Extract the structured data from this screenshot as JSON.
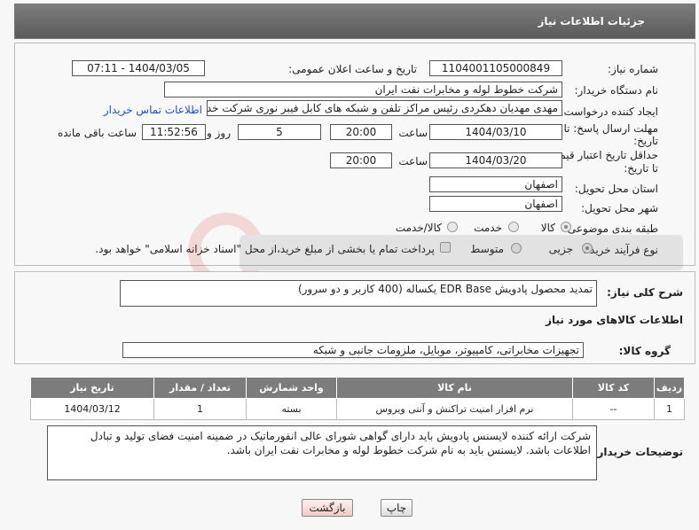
{
  "header": {
    "title": "جزئیات اطلاعات نیاز"
  },
  "form": {
    "need_number_label": "شماره نیاز:",
    "need_number": "1104001105000849",
    "announce_label": "تاریخ و ساعت اعلان عمومی:",
    "announce_value": "1404/03/05 - 07:11",
    "buyer_org_label": "نام دستگاه خریدار:",
    "buyer_org": "شرکت خطوط لوله و مخابرات نفت ایران",
    "requester_label": "ایجاد کننده درخواست:",
    "requester": "مهدی مهدیان دهکردی رئیس مراکز تلفن و شبکه های کابل فیبر نوری شرکت خد",
    "contact_link": "اطلاعات تماس خریدار",
    "reply_deadline_label": "مهلت ارسال پاسخ: تا",
    "reply_deadline_label2": "تاریخ:",
    "reply_date": "1404/03/10",
    "time_label": "ساعت",
    "reply_time": "20:00",
    "days_value": "5",
    "days_label": "روز و",
    "remaining_time": "11:52:56",
    "remaining_label": "ساعت باقی مانده",
    "price_deadline_label": "حداقل تاریخ اعتبار قیمت:",
    "price_deadline_label2": "تا تاریخ:",
    "price_date": "1404/03/20",
    "price_time": "20:00",
    "province_label": "استان محل تحویل:",
    "province": "اصفهان",
    "city_label": "شهر محل تحویل:",
    "city": "اصفهان",
    "category_label": "طبقه بندی موضوعی:",
    "category_options": [
      "کالا",
      "خدمت",
      "کالا/خدمت"
    ],
    "process_label": "نوع فرآیند خرید :",
    "process_options": [
      "جزیی",
      "متوسط"
    ],
    "payment_note": "پرداخت تمام یا بخشی از مبلغ خرید،از محل \"اسناد خزانه اسلامی\" خواهد بود."
  },
  "description": {
    "label": "شرح کلی نیاز:",
    "value": "تمدید محصول پادویش EDR Base یکساله (400 کاربر و دو سرور)"
  },
  "goods": {
    "section_title": "اطلاعات کالاهای مورد نیاز",
    "group_label": "گروه کالا:",
    "group_value": "تجهیزات مخابراتی، کامپیوتر، موبایل، ملزومات جانبی و شبکه",
    "columns": [
      "ردیف",
      "کد کالا",
      "نام کالا",
      "واحد شمارش",
      "تعداد / مقدار",
      "تاریخ نیاز"
    ],
    "rows": [
      [
        "1",
        "--",
        "نرم افزار امنیت تراکنش و آنتی ویروس",
        "بسته",
        "1",
        "1404/03/12"
      ]
    ]
  },
  "buyer_notes": {
    "label": "توضیحات خریدار:",
    "value": "شرکت ارائه کننده لایسنس پادویش باید دارای گواهی شورای عالی انفورماتیک در ضمینه امنیت فضای تولید و تبادل اطلاعات باشد. لایسنس باید به نام شرکت خطوط لوله و مخابرات نفت ایران باشد."
  },
  "buttons": {
    "print": "چاپ",
    "back": "بازگشت"
  },
  "colors": {
    "header": "#6b6b6b",
    "link": "#1a4fd6",
    "table_header": "#7c7c7c"
  }
}
